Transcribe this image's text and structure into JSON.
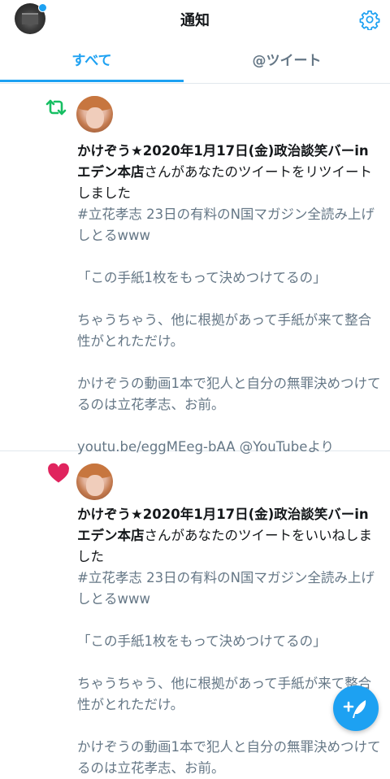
{
  "header": {
    "title": "通知",
    "profile_avatar": "profile-avatar",
    "settings_icon": "gear-icon"
  },
  "tabs": [
    {
      "label": "すべて",
      "active": true
    },
    {
      "label": "@ツイート",
      "active": false
    }
  ],
  "notifications": [
    {
      "kind_icon": "retweet-icon",
      "kind_color": "#17bf63",
      "user_name": "かけぞう★2020年1月17日(金)政治談笑バーinエデン本店",
      "action_text": "さんがあなたのツイートをリツイートしました",
      "tweet_lines": [
        "#立花孝志 23日の有料のN国マガジン全読み上げしとるwww",
        "",
        "「この手紙1枚をもって決めつけてるの」",
        "",
        "ちゃうちゃう、他に根拠があって手紙が来て整合性がとれただけ。",
        "",
        "かけぞうの動画1本で犯人と自分の無罪決めつけてるのは立花孝志、お前。",
        "",
        "youtu.be/eggMEeg-bAA @YouTubeより"
      ]
    },
    {
      "kind_icon": "heart-icon",
      "kind_color": "#e0245e",
      "user_name": "かけぞう★2020年1月17日(金)政治談笑バーinエデン本店",
      "action_text": "さんがあなたのツイートをいいねしました",
      "tweet_lines": [
        "#立花孝志 23日の有料のN国マガジン全読み上げしとるwww",
        "",
        "「この手紙1枚をもって決めつけてるの」",
        "",
        "ちゃうちゃう、他に根拠があって手紙が来て整合性がとれただけ。",
        "",
        "かけぞうの動画1本で犯人と自分の無罪決めつけてるのは立花孝志、お前。"
      ]
    }
  ],
  "compose_button_icon": "compose-tweet-icon",
  "accent_color": "#1da1f2"
}
